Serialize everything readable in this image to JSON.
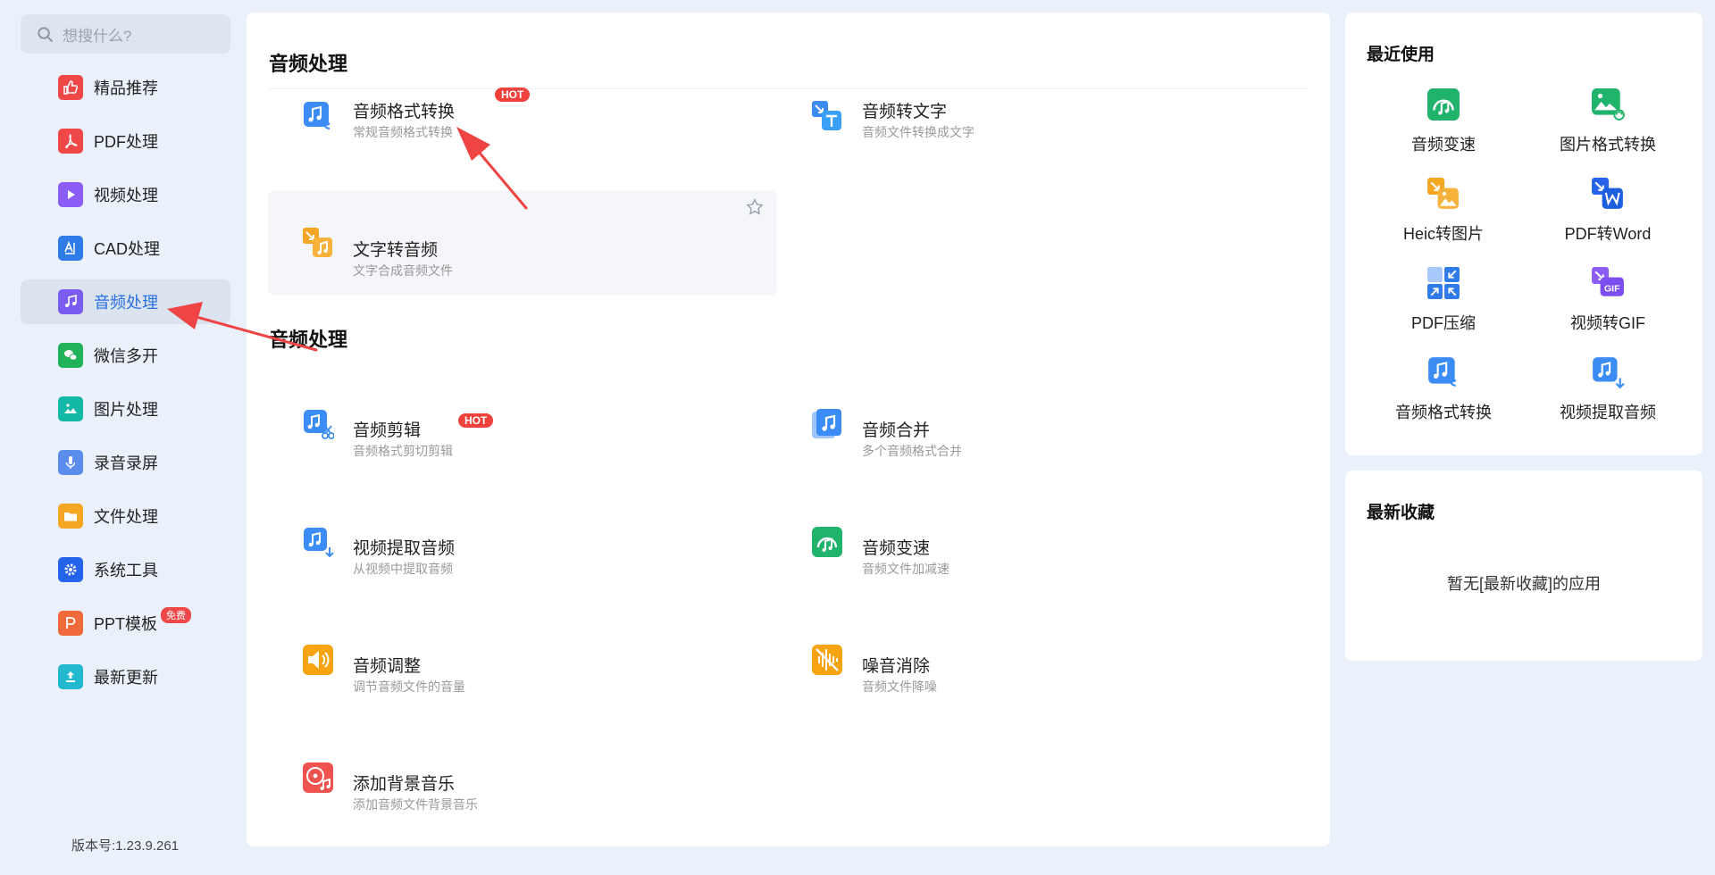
{
  "search": {
    "placeholder": "想搜什么?"
  },
  "sidebar": {
    "items": [
      {
        "label": "精品推荐",
        "icon": "thumbs-up-icon",
        "color": "#f04848"
      },
      {
        "label": "PDF处理",
        "icon": "pdf-icon",
        "color": "#f04848"
      },
      {
        "label": "视频处理",
        "icon": "play-icon",
        "color": "#8b5cf6"
      },
      {
        "label": "CAD处理",
        "icon": "cad-icon",
        "color": "#2f7be8"
      },
      {
        "label": "音频处理",
        "icon": "music-note-icon",
        "color": "#7a5cf0",
        "active": true
      },
      {
        "label": "微信多开",
        "icon": "wechat-icon",
        "color": "#22b35a"
      },
      {
        "label": "图片处理",
        "icon": "image-icon",
        "color": "#14b8a6"
      },
      {
        "label": "录音录屏",
        "icon": "microphone-icon",
        "color": "#5b8def"
      },
      {
        "label": "文件处理",
        "icon": "folder-icon",
        "color": "#f5a623"
      },
      {
        "label": "系统工具",
        "icon": "gear-icon",
        "color": "#2563eb"
      },
      {
        "label": "PPT模板",
        "icon": "ppt-icon",
        "color": "#f06a3c",
        "badge": "免费"
      },
      {
        "label": "最新更新",
        "icon": "upload-icon",
        "color": "#22b8cf"
      }
    ]
  },
  "version": "版本号:1.23.9.261",
  "main": {
    "section1_title": "音频处理",
    "section2_title": "音频处理",
    "hot_label": "HOT",
    "tools_top": [
      {
        "title": "音频格式转换",
        "desc": "常规音频格式转换",
        "icon": "audio-convert-icon"
      },
      {
        "title": "音频转文字",
        "desc": "音频文件转换成文字",
        "icon": "audio-to-text-icon"
      },
      {
        "title": "文字转音频",
        "desc": "文字合成音频文件",
        "icon": "text-to-audio-icon"
      }
    ],
    "tools": [
      {
        "title": "音频剪辑",
        "desc": "音频格式剪切剪辑",
        "icon": "audio-cut-icon"
      },
      {
        "title": "音频合并",
        "desc": "多个音频格式合并",
        "icon": "audio-merge-icon"
      },
      {
        "title": "视频提取音频",
        "desc": "从视频中提取音频",
        "icon": "video-extract-audio-icon"
      },
      {
        "title": "音频变速",
        "desc": "音频文件加减速",
        "icon": "audio-speed-icon"
      },
      {
        "title": "音频调整",
        "desc": "调节音频文件的音量",
        "icon": "volume-icon"
      },
      {
        "title": "噪音消除",
        "desc": "音频文件降噪",
        "icon": "noise-remove-icon"
      },
      {
        "title": "添加背景音乐",
        "desc": "添加音频文件背景音乐",
        "icon": "background-music-icon"
      }
    ]
  },
  "recent": {
    "title": "最近使用",
    "items": [
      {
        "label": "音频变速",
        "icon": "audio-speed-icon"
      },
      {
        "label": "图片格式转换",
        "icon": "image-convert-icon"
      },
      {
        "label": "Heic转图片",
        "icon": "heic-icon"
      },
      {
        "label": "PDF转Word",
        "icon": "pdf-to-word-icon"
      },
      {
        "label": "PDF压缩",
        "icon": "pdf-compress-icon"
      },
      {
        "label": "视频转GIF",
        "icon": "video-to-gif-icon"
      },
      {
        "label": "音频格式转换",
        "icon": "audio-convert-icon"
      },
      {
        "label": "视频提取音频",
        "icon": "video-extract-audio-icon"
      }
    ]
  },
  "favorites": {
    "title": "最新收藏",
    "empty_text": "暂无[最新收藏]的应用"
  },
  "colors": {
    "accent": "#2b6fe0",
    "hot": "#f0413c",
    "annotation_arrow": "#ef4444"
  }
}
